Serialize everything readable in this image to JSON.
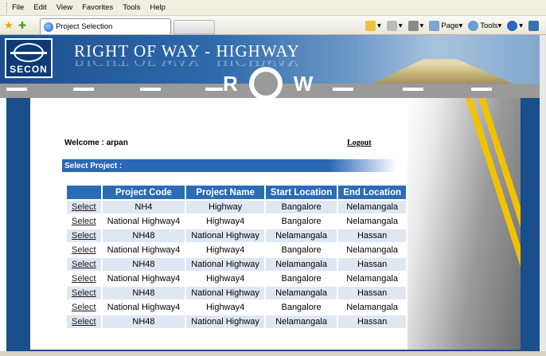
{
  "menu": [
    "File",
    "Edit",
    "View",
    "Favorites",
    "Tools",
    "Help"
  ],
  "tab": {
    "title": "Project Selection"
  },
  "toolbar": {
    "page": "Page",
    "tools": "Tools"
  },
  "banner": {
    "title": "RIGHT OF WAY - HIGHWAY",
    "logo_text": "SECON",
    "row_r": "R",
    "row_w": "W"
  },
  "welcome": "Welcome : arpan",
  "logout": "Logout",
  "select_header": "Select Project :",
  "table": {
    "headers": [
      "",
      "Project Code",
      "Project Name",
      "Start Location",
      "End Location"
    ],
    "rows": [
      [
        "Select",
        "NH4",
        "Highway",
        "Bangalore",
        "Nelamangala"
      ],
      [
        "Select",
        "National Highway4",
        "Highway4",
        "Bangalore",
        "Nelamangala"
      ],
      [
        "Select",
        "NH48",
        "National Highway",
        "Nelamangala",
        "Hassan"
      ],
      [
        "Select",
        "National Highway4",
        "Highway4",
        "Bangalore",
        "Nelamangala"
      ],
      [
        "Select",
        "NH48",
        "National Highway",
        "Nelamangala",
        "Hassan"
      ],
      [
        "Select",
        "National Highway4",
        "Highway4",
        "Bangalore",
        "Nelamangala"
      ],
      [
        "Select",
        "NH48",
        "National Highway",
        "Nelamangala",
        "Hassan"
      ],
      [
        "Select",
        "National Highway4",
        "Highway4",
        "Bangalore",
        "Nelamangala"
      ],
      [
        "Select",
        "NH48",
        "National Highway",
        "Nelamangala",
        "Hassan"
      ]
    ]
  },
  "colors": {
    "header": "#2b6cb6",
    "alt_row": "#dfe7f3",
    "frame": "#1b4e8c"
  }
}
